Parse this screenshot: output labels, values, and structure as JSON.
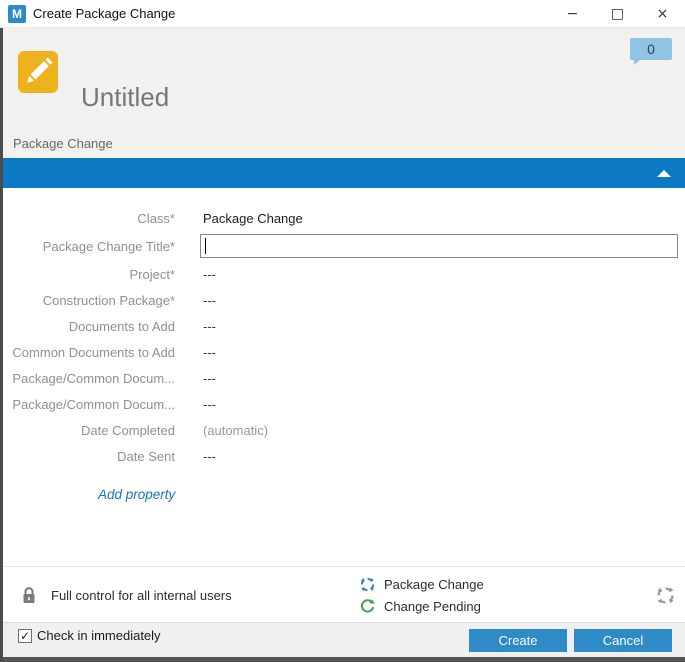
{
  "window": {
    "title": "Create Package Change",
    "app_icon_letter": "M",
    "minimize_glyph": "−",
    "maximize_glyph": "□",
    "close_glyph": "×"
  },
  "header": {
    "object_title": "Untitled",
    "comments_count": "0"
  },
  "tab": {
    "label": "Package Change"
  },
  "form": {
    "properties": [
      {
        "label": "Class*",
        "value": "Package Change",
        "type": "class"
      },
      {
        "label": "Package Change Title*",
        "value": "",
        "type": "input"
      },
      {
        "label": "Project*",
        "value": "---",
        "type": "text"
      },
      {
        "label": "Construction Package*",
        "value": "---",
        "type": "text"
      },
      {
        "label": "Documents to Add",
        "value": "---",
        "type": "text"
      },
      {
        "label": "Common Documents to Add",
        "value": "---",
        "type": "text"
      },
      {
        "label": "Package/Common Docum...",
        "value": "---",
        "type": "text"
      },
      {
        "label": "Package/Common Docum...",
        "value": "---",
        "type": "text"
      },
      {
        "label": "Date Completed",
        "value": "(automatic)",
        "type": "muted"
      },
      {
        "label": "Date Sent",
        "value": "---",
        "type": "text"
      }
    ],
    "add_property_label": "Add property"
  },
  "footer": {
    "permissions_text": "Full control for all internal users",
    "workflow_name": "Package Change",
    "state_name": "Change Pending"
  },
  "bottom_bar": {
    "checkin_label": "Check in immediately",
    "checkin_checked": true,
    "check_glyph": "✓",
    "create_label": "Create",
    "cancel_label": "Cancel"
  },
  "colors": {
    "accent_blue": "#0b79c4",
    "button_blue": "#2e8bc8",
    "badge_blue": "#8fc4e2",
    "icon_yellow": "#efb21f",
    "workflow_blue": "#2e7ec9",
    "state_green": "#44a04a",
    "refresh_gray": "#9a9a9a"
  }
}
